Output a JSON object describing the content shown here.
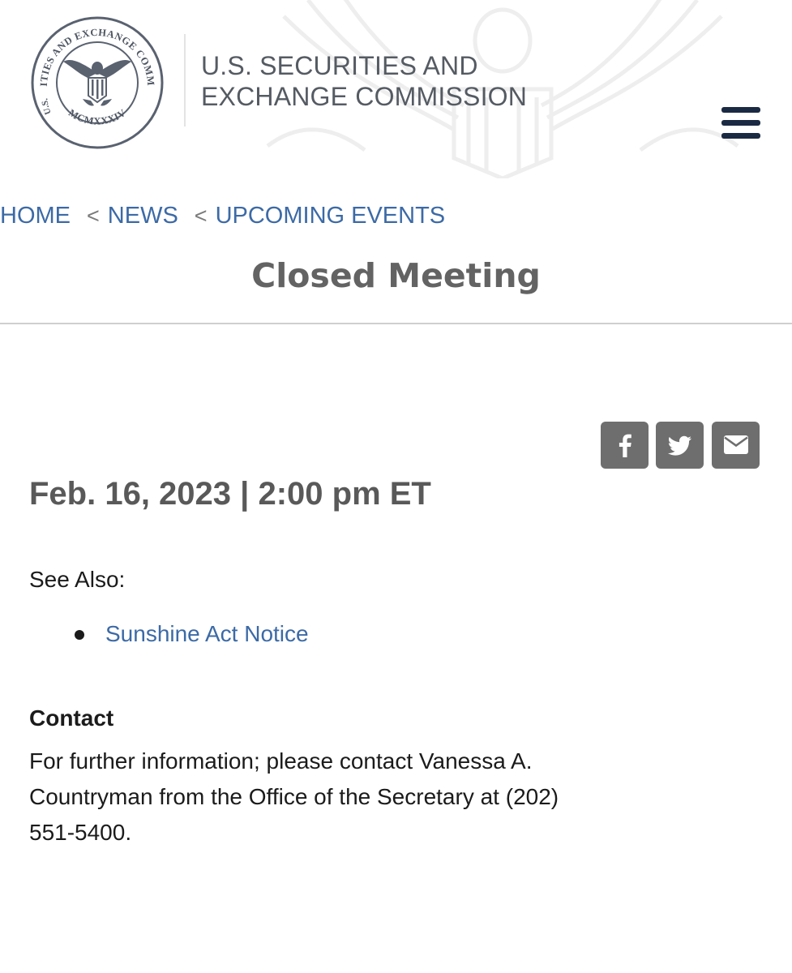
{
  "header": {
    "agency_name": "U.S. SECURITIES AND EXCHANGE COMMISSION",
    "seal": {
      "ring_text_top": "SECURITIES AND EXCHANGE COMMISSION",
      "ring_text_bottom": "MCMXXXIV",
      "ring_text_left": "U.S."
    }
  },
  "nav": {
    "menu_icon": "hamburger-menu-icon"
  },
  "breadcrumb": {
    "items": [
      "HOME",
      "NEWS",
      "UPCOMING EVENTS"
    ],
    "separator": "<"
  },
  "page": {
    "title": "Closed Meeting"
  },
  "share": {
    "icons": [
      "facebook-icon",
      "twitter-icon",
      "email-icon"
    ]
  },
  "event": {
    "datetime": "Feb. 16, 2023 | 2:00 pm ET"
  },
  "see_also": {
    "label": "See Also:",
    "links": [
      "Sunshine Act Notice"
    ]
  },
  "contact": {
    "heading": "Contact",
    "text": "For further information; please contact Vanessa A. Countryman from the Office of the Secretary at (202) 551-5400."
  },
  "colors": {
    "link": "#3c6aa6",
    "menu": "#1b2a43",
    "share_button": "#6e6e6e",
    "title": "#636363"
  }
}
